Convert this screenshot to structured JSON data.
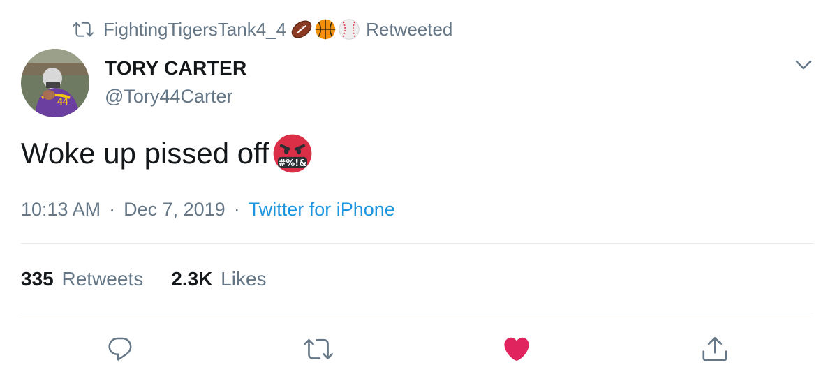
{
  "retweet": {
    "icon": "retweet-icon",
    "user": "FightingTigersTank4_4",
    "emojis": [
      "football-emoji",
      "basketball-emoji",
      "baseball-emoji"
    ],
    "suffix": "Retweeted"
  },
  "author": {
    "name": "TORY CARTER",
    "handle": "@Tory44Carter",
    "avatar": "avatar"
  },
  "tweet": {
    "text": "Woke up pissed off",
    "emoji": "face-with-symbols-on-mouth-emoji"
  },
  "meta": {
    "time": "10:13 AM",
    "separator": "·",
    "date": "Dec 7, 2019",
    "source": "Twitter for iPhone"
  },
  "stats": {
    "retweets_count": "335",
    "retweets_label": "Retweets",
    "likes_count": "2.3K",
    "likes_label": "Likes"
  },
  "actions": [
    "reply-icon",
    "retweet-icon",
    "like-icon",
    "share-icon"
  ],
  "colors": {
    "secondary_text": "#657786",
    "link": "#1b95e0",
    "like": "#e0245e",
    "divider": "#e6ecf0"
  }
}
